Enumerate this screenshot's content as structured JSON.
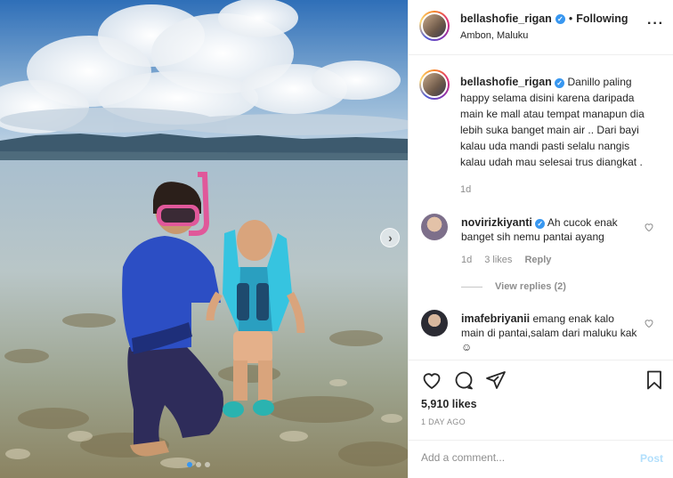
{
  "post": {
    "username": "bellashofie_rigan",
    "following_label": "Following",
    "bullet": "•",
    "location": "Ambon, Maluku",
    "more_icon": "more-dots-icon",
    "caption": {
      "username": "bellashofie_rigan",
      "text": "Danillo paling happy selama disini karena daripada main ke mall atau tempat manapun dia lebih suka banget main air .. Dari bayi kalau uda mandi pasti selalu nangis kalau udah mau selesai trus diangkat .",
      "time": "1d"
    },
    "comments": [
      {
        "username": "novirizkiyanti",
        "verified": true,
        "text": "Ah cucok enak banget sih nemu pantai ayang",
        "time": "1d",
        "likes": "3 likes",
        "reply": "Reply",
        "view_replies": "View replies (2)"
      },
      {
        "username": "imafebriyanii",
        "verified": false,
        "text": "emang enak kalo main di pantai,salam dari maluku kak ☺"
      }
    ],
    "likes": "5,910 likes",
    "timestamp": "1 DAY AGO",
    "add_comment_placeholder": "Add a comment...",
    "post_label": "Post",
    "carousel": {
      "total": 3,
      "active": 0
    }
  },
  "colors": {
    "accent": "#3897f0",
    "post_disabled": "#b2dffc",
    "muted": "#8e8e8e"
  }
}
